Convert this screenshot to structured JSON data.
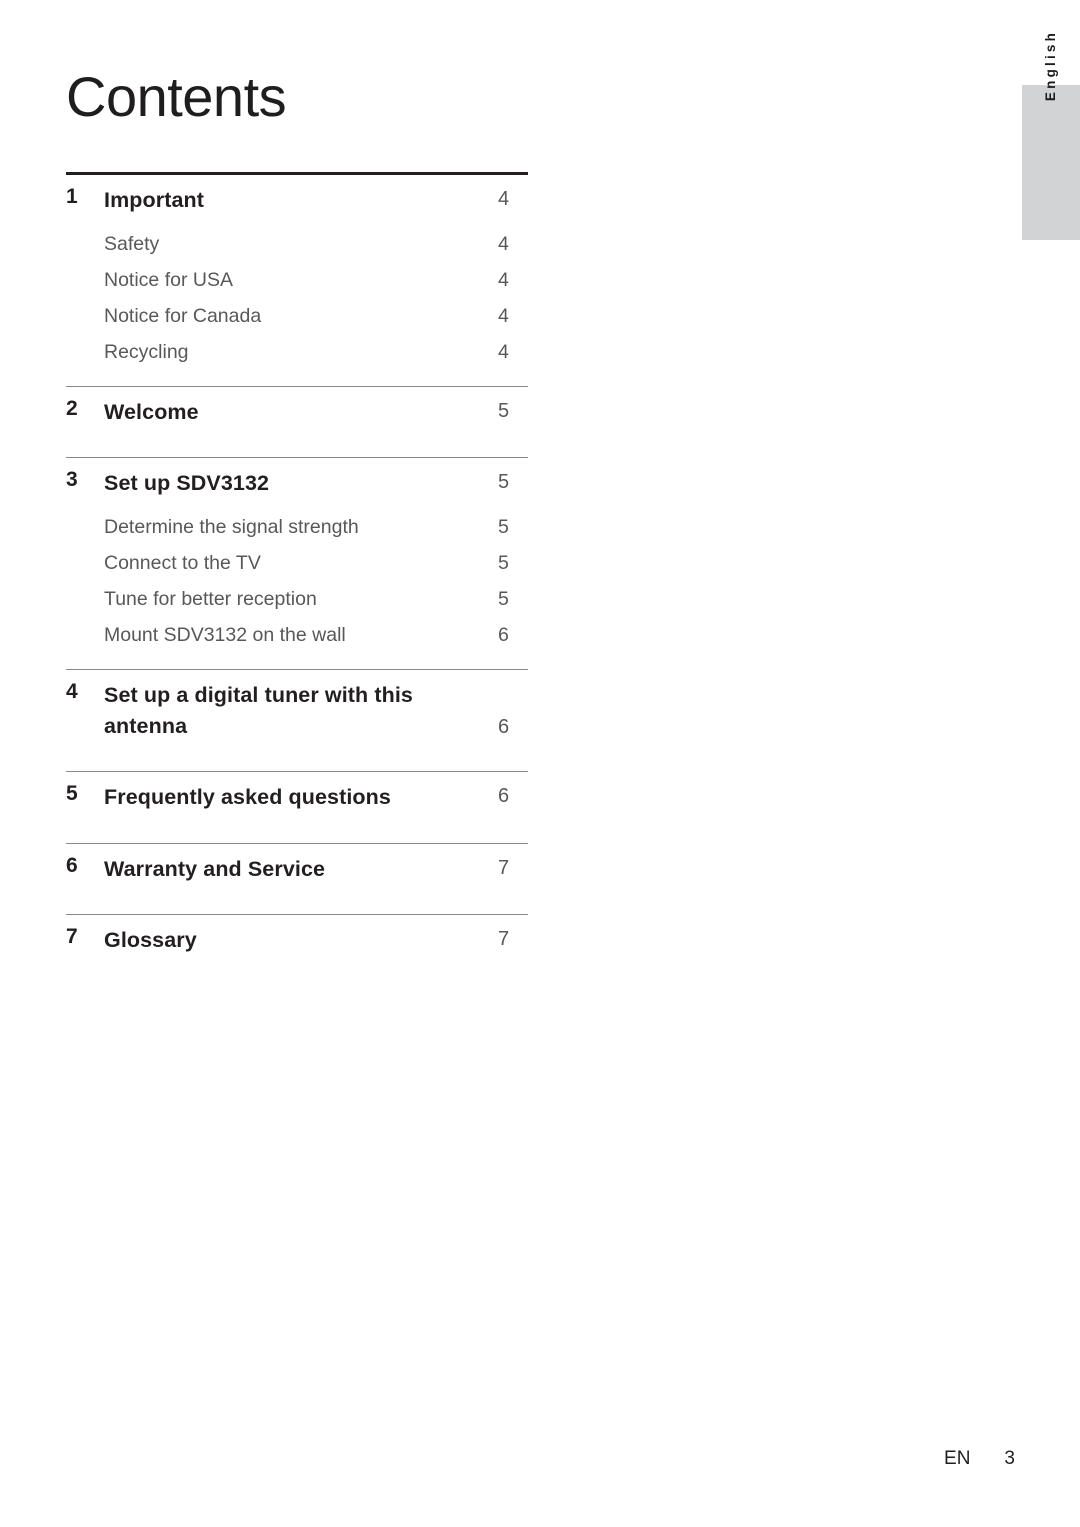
{
  "document": {
    "title": "Contents",
    "language_tab": "English"
  },
  "toc": {
    "sections": [
      {
        "number": "1",
        "title": "Important",
        "page": "4",
        "subitems": [
          {
            "title": "Safety",
            "page": "4"
          },
          {
            "title": "Notice for USA",
            "page": "4"
          },
          {
            "title": "Notice for Canada",
            "page": "4"
          },
          {
            "title": "Recycling",
            "page": "4"
          }
        ]
      },
      {
        "number": "2",
        "title": "Welcome",
        "page": "5",
        "subitems": []
      },
      {
        "number": "3",
        "title": "Set up SDV3132",
        "page": "5",
        "subitems": [
          {
            "title": "Determine the signal strength",
            "page": "5"
          },
          {
            "title": "Connect to the TV",
            "page": "5"
          },
          {
            "title": "Tune for better reception",
            "page": "5"
          },
          {
            "title": "Mount SDV3132 on the wall",
            "page": "6"
          }
        ]
      },
      {
        "number": "4",
        "title": "Set up a digital tuner with this antenna",
        "page": "6",
        "subitems": []
      },
      {
        "number": "5",
        "title": "Frequently asked questions",
        "page": "6",
        "subitems": []
      },
      {
        "number": "6",
        "title": "Warranty and Service",
        "page": "7",
        "subitems": []
      },
      {
        "number": "7",
        "title": "Glossary",
        "page": "7",
        "subitems": []
      }
    ]
  },
  "footer": {
    "locale": "EN",
    "page_number": "3"
  },
  "colors": {
    "ink": "#231f20",
    "muted": "#58585a",
    "tab_background": "#d2d3d5",
    "rule": "#8a8a8d"
  }
}
